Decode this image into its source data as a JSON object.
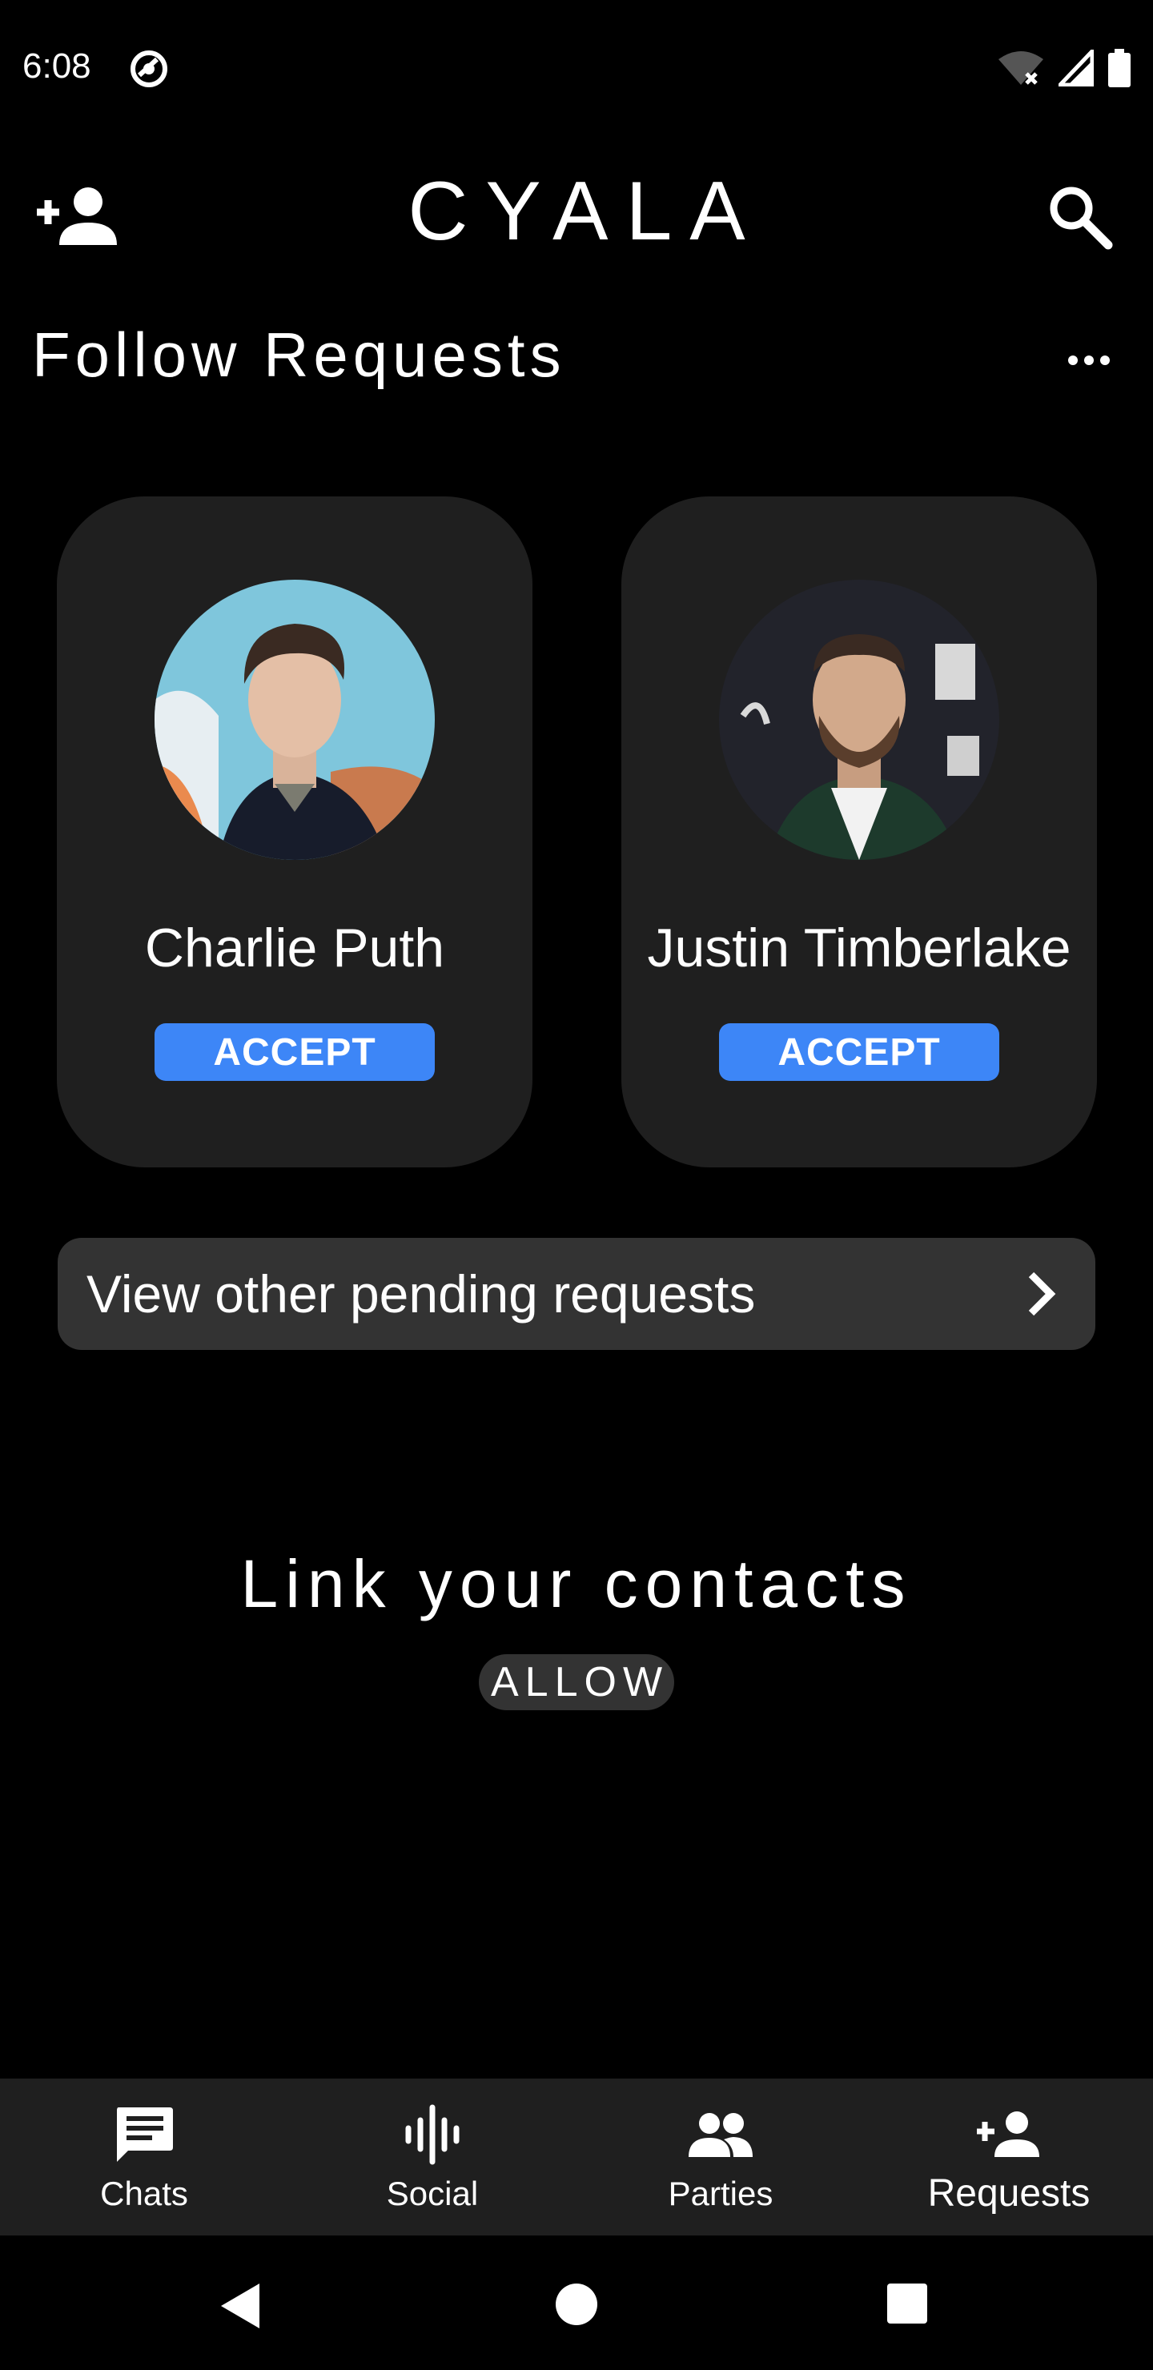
{
  "status_bar": {
    "time": "6:08"
  },
  "header": {
    "title": "CYALA",
    "add_icon": "person-add-icon",
    "search_icon": "search-icon"
  },
  "follow_requests": {
    "title": "Follow Requests",
    "more_icon": "more-horizontal-icon",
    "cards": [
      {
        "name": "Charlie Puth",
        "button": "ACCEPT"
      },
      {
        "name": "Justin Timberlake",
        "button": "ACCEPT"
      }
    ],
    "pending_label": "View other pending requests"
  },
  "contacts": {
    "title": "Link your contacts",
    "allow_label": "ALLOW"
  },
  "bottom_nav": {
    "items": [
      {
        "label": "Chats",
        "icon": "chat-icon"
      },
      {
        "label": "Social",
        "icon": "audio-wave-icon"
      },
      {
        "label": "Parties",
        "icon": "group-icon"
      },
      {
        "label": "Requests",
        "icon": "person-add-icon"
      }
    ],
    "active": "Requests"
  },
  "colors": {
    "accent": "#3d86f7",
    "card_bg": "#1f1f1f",
    "row_bg": "#333333",
    "background": "#000000"
  }
}
